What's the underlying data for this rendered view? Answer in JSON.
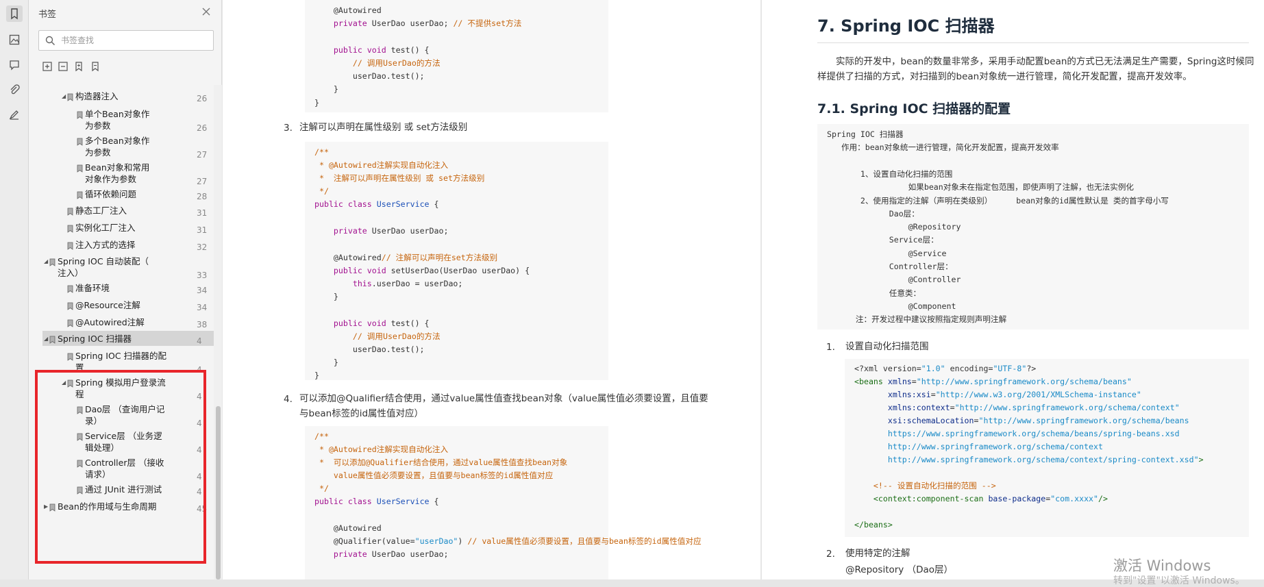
{
  "panel": {
    "title": "书签",
    "search_placeholder": "书签查找"
  },
  "bookmarks": [
    {
      "label": "构造器注入",
      "page": "26",
      "level": 2,
      "expanded": true
    },
    {
      "label": "单个Bean对象作为参数",
      "label_l1": "单个Bean对象作",
      "label_l2": "为参数",
      "page": "26",
      "level": 3
    },
    {
      "label": "多个Bean对象作为参数",
      "label_l1": "多个Bean对象作",
      "label_l2": "为参数",
      "page": "27",
      "level": 3
    },
    {
      "label": "Bean对象和常用对象作为参数",
      "label_l1": "Bean对象和常用",
      "label_l2": "对象作为参数",
      "page": "27",
      "level": 3
    },
    {
      "label": "循环依赖问题",
      "page": "28",
      "level": 3
    },
    {
      "label": "静态工厂注入",
      "page": "31",
      "level": 2
    },
    {
      "label": "实例化工厂注入",
      "page": "31",
      "level": 2
    },
    {
      "label": "注入方式的选择",
      "page": "32",
      "level": 2
    },
    {
      "label": "Spring IOC 自动装配（注入）",
      "label_l1": "Spring IOC 自动装配（",
      "label_l2": "注入）",
      "page": "33",
      "level": 1,
      "expanded": true
    },
    {
      "label": "准备环境",
      "page": "34",
      "level": 2
    },
    {
      "label": "@Resource注解",
      "page": "34",
      "level": 2
    },
    {
      "label": "@Autowired注解",
      "page": "38",
      "level": 2
    },
    {
      "label": "Spring IOC 扫描器",
      "page": "4",
      "level": 1,
      "expanded": true,
      "selected": true
    },
    {
      "label": "Spring IOC 扫描器的配置",
      "label_l1": "Spring IOC 扫描器的配",
      "label_l2": "置",
      "page": "4",
      "level": 2
    },
    {
      "label": "Spring 模拟用户登录流程",
      "label_l1": "Spring 模拟用户登录流",
      "label_l2": "程",
      "page": "4",
      "level": 2,
      "expanded": true
    },
    {
      "label": "Dao层 （查询用户记录）",
      "label_l1": "Dao层 （查询用户记",
      "label_l2": "录）",
      "page": "4",
      "level": 3
    },
    {
      "label": "Service层 （业务逻辑处理）",
      "label_l1": "Service层 （业务逻",
      "label_l2": "辑处理）",
      "page": "4",
      "level": 3
    },
    {
      "label": "Controller层 （接收请求）",
      "label_l1": "Controller层 （接收",
      "label_l2": "请求）",
      "page": "4",
      "level": 3
    },
    {
      "label": "通过 JUnit 进行测试",
      "page": "4",
      "level": 3
    },
    {
      "label": "Bean的作用域与生命周期",
      "page": "45",
      "level": 1
    }
  ],
  "page1": {
    "item3_num": "3.",
    "item3_text": "注解可以声明在属性级别 或 set方法级别",
    "item4_num": "4.",
    "item4_text_l1": "可以添加@Qualifier结合使用，通过value属性值查找bean对象（value属性值必须要设置，且值要",
    "item4_text_l2": "与bean标签的id属性值对应）"
  },
  "page2": {
    "heading": "7. Spring IOC 扫描器",
    "intro_l1": "实际的开发中，bean的数量非常多，采用手动配置bean的方式已无法满足生产需要，Spring这时候同",
    "intro_l2": "样提供了扫描的方式，对扫描到的bean对象统一进行管理，简化开发配置，提高开发效率。",
    "subheading": "7.1. Spring IOC 扫描器的配置",
    "summary_lines": [
      "Spring IOC 扫描器",
      "   作用：bean对象统一进行管理，简化开发配置，提高开发效率",
      "",
      "       1、设置自动化扫描的范围",
      "                 如果bean对象未在指定包范围，即使声明了注解，也无法实例化",
      "       2、使用指定的注解（声明在类级别）     bean对象的id属性默认是 类的首字母小写",
      "             Dao层：",
      "                 @Repository",
      "             Service层：",
      "                 @Service",
      "             Controller层：",
      "                 @Controller",
      "             任意类：",
      "                 @Component",
      "      注：开发过程中建议按照指定规则声明注解"
    ],
    "step1_num": "1.",
    "step1_text": "设置自动化扫描范围",
    "step2_num": "2.",
    "step2_text": "使用特定的注解",
    "step2_sub": "@Repository  （Dao层）"
  },
  "watermark": {
    "line1": "激活 Windows",
    "line2": "转到\"设置\"以激活 Windows。"
  }
}
